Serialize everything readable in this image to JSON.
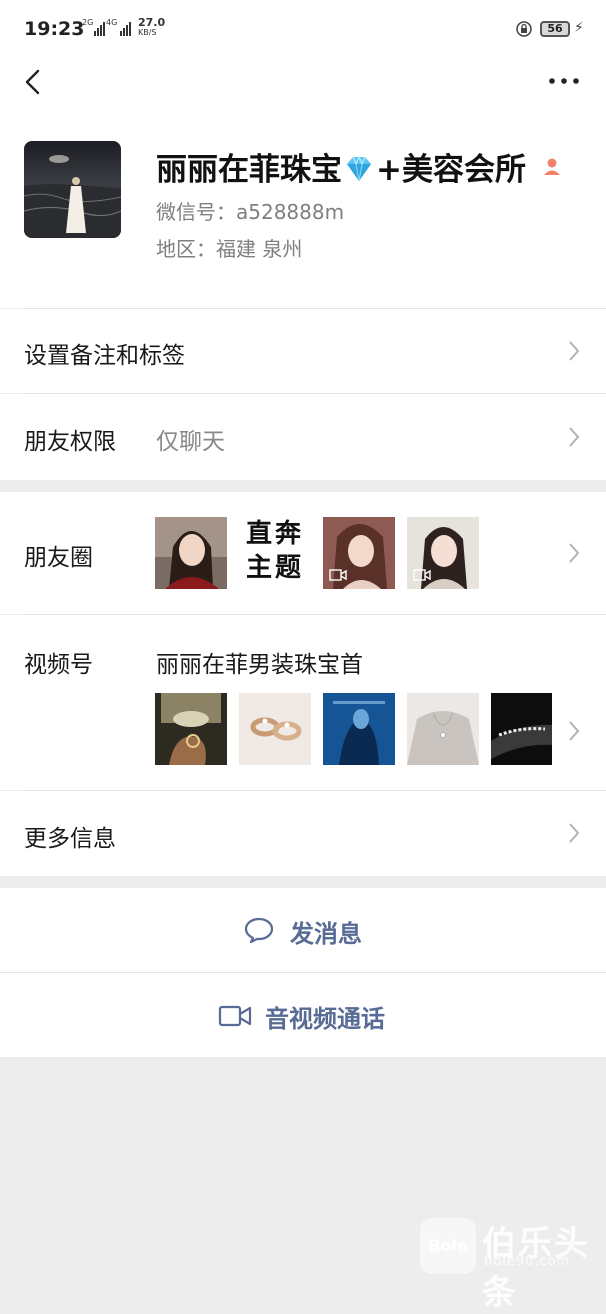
{
  "status_bar": {
    "time": "19:23",
    "net1": "2G",
    "net2": "4G",
    "speed_value": "27.0",
    "speed_unit": "KB/S",
    "battery": "56"
  },
  "profile": {
    "name_part1": "丽丽在菲珠宝",
    "name_part2": "+美容会所",
    "wechat_id": "微信号：a528888m",
    "region": "地区：福建  泉州"
  },
  "rows": {
    "remark_label": "设置备注和标签",
    "permission_label": "朋友权限",
    "permission_value": "仅聊天",
    "moments_label": "朋友圈",
    "moments_text_thumb_line1": "直奔",
    "moments_text_thumb_line2": "主题",
    "channels_label": "视频号",
    "channels_name": "丽丽在菲男装珠宝首",
    "more_label": "更多信息"
  },
  "actions": {
    "message": "发消息",
    "call": "音视频通话"
  },
  "watermark": {
    "logo": "Bole",
    "brand": "伯乐头条",
    "site": "bole90.com"
  },
  "colors": {
    "link_blue": "#576b95",
    "background": "#ededed",
    "gray_text": "#7f7f7f"
  }
}
